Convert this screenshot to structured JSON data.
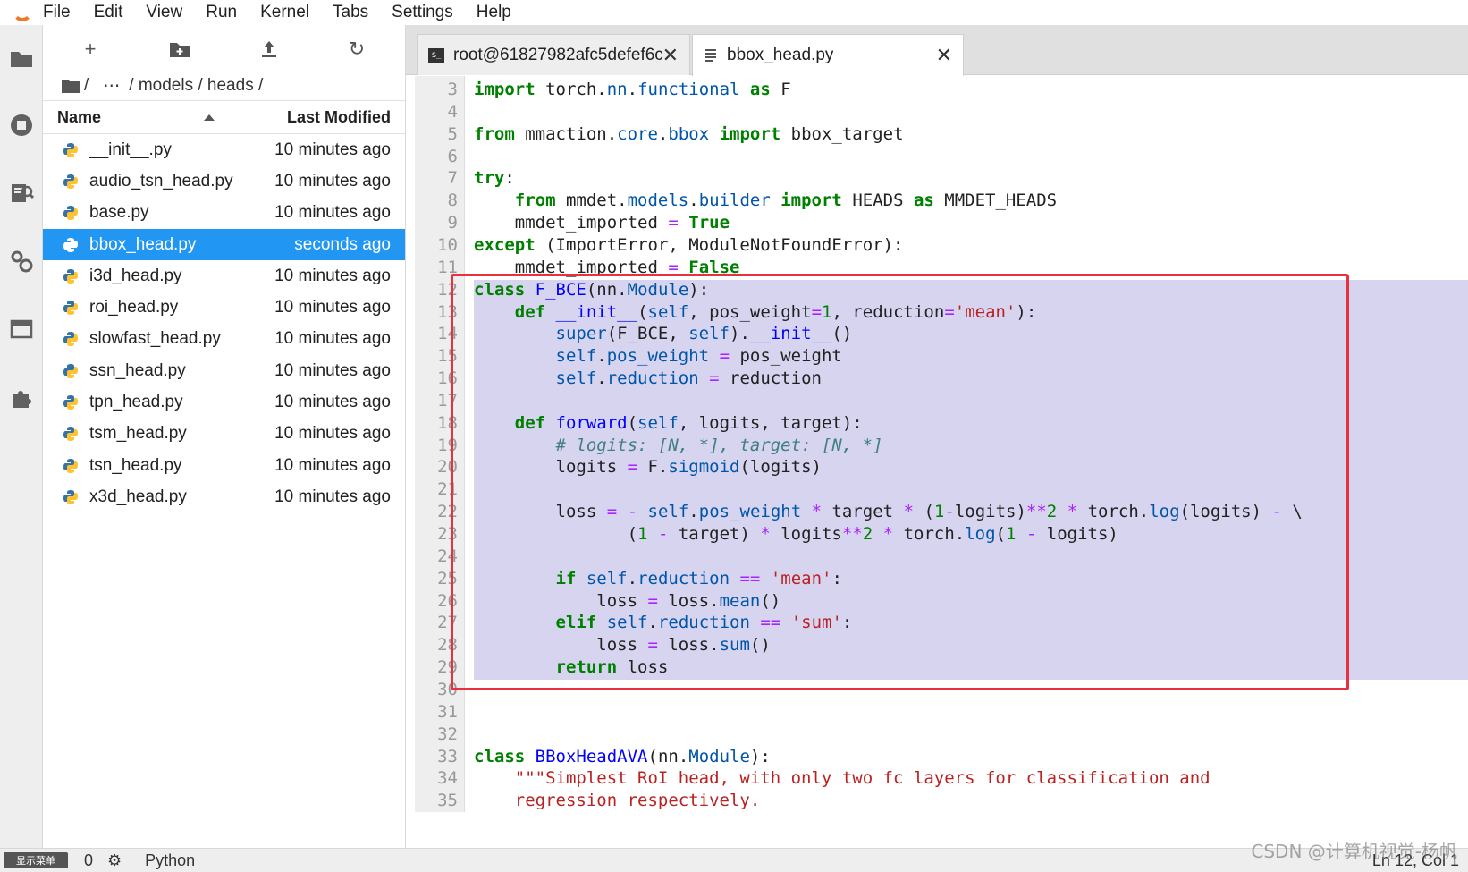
{
  "menubar": {
    "items": [
      "File",
      "Edit",
      "View",
      "Run",
      "Kernel",
      "Tabs",
      "Settings",
      "Help"
    ]
  },
  "filebrowser": {
    "toolbar": {
      "new": "+",
      "refresh": "↻"
    },
    "breadcrumb": {
      "root": "/",
      "ellipsis": "⋯",
      "path": "/ models / heads /"
    },
    "header": {
      "name": "Name",
      "last_modified": "Last Modified"
    },
    "files": [
      {
        "name": "__init__.py",
        "modified": "10 minutes ago",
        "selected": false
      },
      {
        "name": "audio_tsn_head.py",
        "modified": "10 minutes ago",
        "selected": false
      },
      {
        "name": "base.py",
        "modified": "10 minutes ago",
        "selected": false
      },
      {
        "name": "bbox_head.py",
        "modified": "seconds ago",
        "selected": true
      },
      {
        "name": "i3d_head.py",
        "modified": "10 minutes ago",
        "selected": false
      },
      {
        "name": "roi_head.py",
        "modified": "10 minutes ago",
        "selected": false
      },
      {
        "name": "slowfast_head.py",
        "modified": "10 minutes ago",
        "selected": false
      },
      {
        "name": "ssn_head.py",
        "modified": "10 minutes ago",
        "selected": false
      },
      {
        "name": "tpn_head.py",
        "modified": "10 minutes ago",
        "selected": false
      },
      {
        "name": "tsm_head.py",
        "modified": "10 minutes ago",
        "selected": false
      },
      {
        "name": "tsn_head.py",
        "modified": "10 minutes ago",
        "selected": false
      },
      {
        "name": "x3d_head.py",
        "modified": "10 minutes ago",
        "selected": false
      }
    ]
  },
  "tabs": {
    "terminal": "root@61827982afc5defef6c",
    "file": "bbox_head.py",
    "close": "✕"
  },
  "editor": {
    "line_numbers": [
      "3",
      "4",
      "5",
      "6",
      "7",
      "8",
      "9",
      "10",
      "11",
      "12",
      "13",
      "14",
      "15",
      "16",
      "17",
      "18",
      "19",
      "20",
      "21",
      "22",
      "23",
      "24",
      "25",
      "26",
      "27",
      "28",
      "29",
      "30",
      "31",
      "32",
      "33",
      "34",
      "35"
    ]
  },
  "statusbar": {
    "mode_label": "显示菜单",
    "terminals": "0",
    "kernel": "Python",
    "cursor": "Ln 12, Col 1"
  },
  "watermark": "CSDN @计算机视觉-杨帆",
  "colors": {
    "accent": "#2196f3",
    "selection": "#d7d4f0",
    "highlight_box": "#e8303e",
    "jupyter_orange": "#f37726"
  }
}
